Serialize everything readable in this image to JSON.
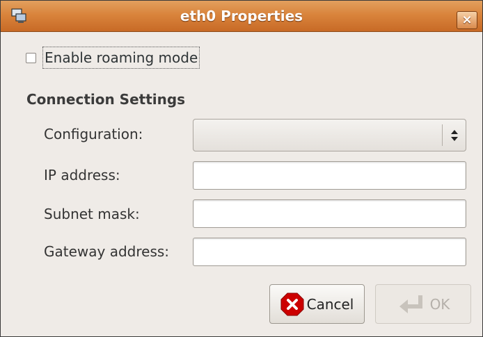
{
  "window": {
    "title": "eth0 Properties",
    "close_glyph": "×"
  },
  "roaming": {
    "label": "Enable roaming mode",
    "checked": false
  },
  "section": {
    "title": "Connection Settings"
  },
  "fields": {
    "configuration_label": "Configuration:",
    "configuration_value": "",
    "ip_label": "IP address:",
    "ip_value": "",
    "subnet_label": "Subnet mask:",
    "subnet_value": "",
    "gateway_label": "Gateway address:",
    "gateway_value": ""
  },
  "buttons": {
    "cancel_label": "Cancel",
    "ok_label": "OK",
    "ok_enabled": false
  },
  "icons": {
    "title": "network-icon",
    "close": "close-icon",
    "combo": "updown-arrows-icon",
    "cancel": "cancel-icon",
    "ok": "enter-arrow-icon"
  },
  "colors": {
    "titlebar": "#d9843c",
    "window_bg": "#efebe7",
    "cancel_icon": "#cc0000"
  }
}
